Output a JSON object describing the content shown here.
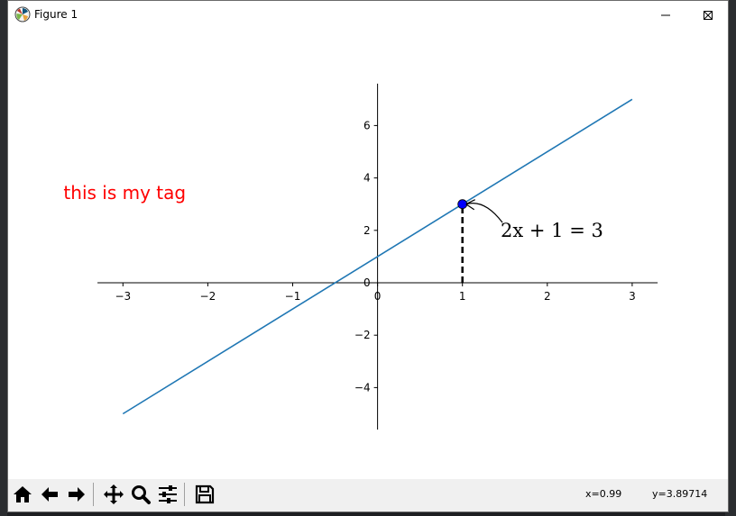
{
  "window": {
    "title": "Figure 1",
    "minimize_icon": "minimize-icon",
    "maximize_icon": "maximize-icon",
    "close_icon": "close-icon"
  },
  "toolbar": {
    "buttons": [
      "home-icon",
      "back-icon",
      "forward-icon",
      "pan-icon",
      "zoom-icon",
      "configure-subplots-icon",
      "save-icon"
    ],
    "x_readout": "x=0.99",
    "y_readout": "y=3.89714"
  },
  "chart_data": {
    "type": "line",
    "title": "",
    "xlabel": "",
    "ylabel": "",
    "xlim": [
      -3.3,
      3.3
    ],
    "ylim": [
      -5.6,
      7.6
    ],
    "spines": "centered at origin",
    "grid": false,
    "xticks": [
      -3,
      -2,
      -1,
      0,
      1,
      2,
      3
    ],
    "xtick_labels": [
      "−3",
      "−2",
      "−1",
      "0",
      "1",
      "2",
      "3"
    ],
    "yticks": [
      -4,
      -2,
      0,
      2,
      4,
      6
    ],
    "ytick_labels": [
      "−4",
      "−2",
      "0",
      "2",
      "4",
      "6"
    ],
    "series": [
      {
        "x": [
          -3,
          3
        ],
        "y": [
          -5,
          7
        ],
        "color": "#1f77b4"
      }
    ],
    "highlight_point": {
      "x": 1,
      "y": 3,
      "color": "#0000ff"
    },
    "dashed_line": {
      "x0": 1,
      "y0": 0,
      "x1": 1,
      "y1": 3,
      "color": "#000000"
    },
    "annotation": {
      "text": "2x + 1 = 3",
      "text_x": 1.45,
      "text_y": 1.75,
      "arrow_to": [
        1,
        3
      ]
    },
    "text_tag": {
      "text": "this is my tag",
      "x": -3.7,
      "y": 3.2,
      "color": "#ff0000"
    }
  }
}
